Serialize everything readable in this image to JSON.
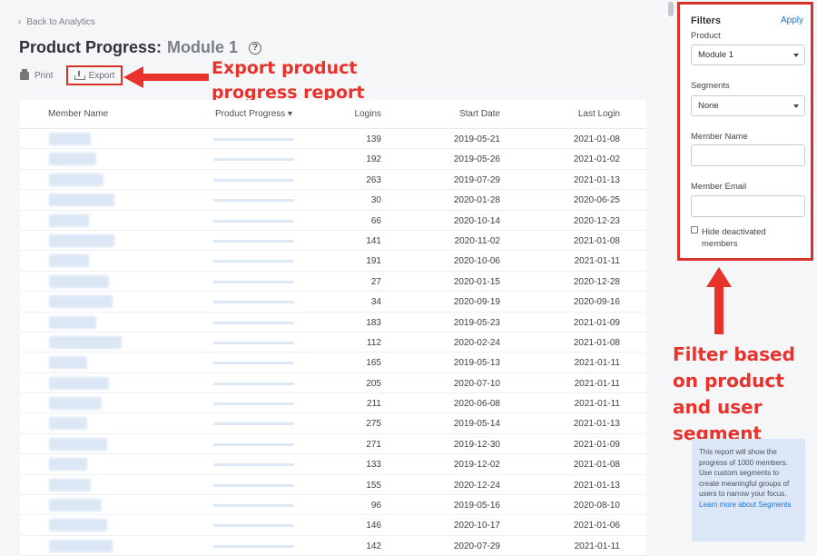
{
  "nav": {
    "back_label": "Back to Analytics"
  },
  "header": {
    "title": "Product Progress:",
    "subtitle": "Module 1",
    "help_glyph": "?"
  },
  "toolbar": {
    "print_label": "Print",
    "export_label": "Export"
  },
  "annotations": {
    "export": "Export product progress report",
    "filter": "Filter based on product and user segment",
    "color": "#e8322b"
  },
  "table": {
    "columns": [
      "Member Name",
      "Product Progress ▾",
      "Logins",
      "Start Date",
      "Last Login"
    ],
    "rows": [
      {
        "name_width": 46,
        "progress": 0.93,
        "logins": "139",
        "start": "2019-05-21",
        "last": "2021-01-08"
      },
      {
        "name_width": 52,
        "progress": 0.86,
        "logins": "192",
        "start": "2019-05-26",
        "last": "2021-01-02"
      },
      {
        "name_width": 60,
        "progress": 0.7,
        "logins": "263",
        "start": "2019-07-29",
        "last": "2021-01-13"
      },
      {
        "name_width": 72,
        "progress": 0.38,
        "logins": "30",
        "start": "2020-01-28",
        "last": "2020-06-25"
      },
      {
        "name_width": 44,
        "progress": 0.14,
        "logins": "66",
        "start": "2020-10-14",
        "last": "2020-12-23"
      },
      {
        "name_width": 72,
        "progress": 0.14,
        "logins": "141",
        "start": "2020-11-02",
        "last": "2021-01-08"
      },
      {
        "name_width": 44,
        "progress": 0.14,
        "logins": "191",
        "start": "2020-10-06",
        "last": "2021-01-11"
      },
      {
        "name_width": 66,
        "progress": 0.14,
        "logins": "27",
        "start": "2020-01-15",
        "last": "2020-12-28"
      },
      {
        "name_width": 70,
        "progress": 0.14,
        "logins": "34",
        "start": "2020-09-19",
        "last": "2020-09-16"
      },
      {
        "name_width": 52,
        "progress": 0.14,
        "logins": "183",
        "start": "2019-05-23",
        "last": "2021-01-09"
      },
      {
        "name_width": 80,
        "progress": 0.14,
        "logins": "112",
        "start": "2020-02-24",
        "last": "2021-01-08"
      },
      {
        "name_width": 42,
        "progress": 0.14,
        "logins": "165",
        "start": "2019-05-13",
        "last": "2021-01-11"
      },
      {
        "name_width": 66,
        "progress": 0.14,
        "logins": "205",
        "start": "2020-07-10",
        "last": "2021-01-11"
      },
      {
        "name_width": 58,
        "progress": 0.14,
        "logins": "211",
        "start": "2020-06-08",
        "last": "2021-01-11"
      },
      {
        "name_width": 42,
        "progress": 0.14,
        "logins": "275",
        "start": "2019-05-14",
        "last": "2021-01-13"
      },
      {
        "name_width": 64,
        "progress": 0.14,
        "logins": "271",
        "start": "2019-12-30",
        "last": "2021-01-09"
      },
      {
        "name_width": 42,
        "progress": 0.14,
        "logins": "133",
        "start": "2019-12-02",
        "last": "2021-01-08"
      },
      {
        "name_width": 46,
        "progress": 0.14,
        "logins": "155",
        "start": "2020-12-24",
        "last": "2021-01-13"
      },
      {
        "name_width": 58,
        "progress": 0.14,
        "logins": "96",
        "start": "2019-05-16",
        "last": "2020-08-10"
      },
      {
        "name_width": 64,
        "progress": 0.14,
        "logins": "146",
        "start": "2020-10-17",
        "last": "2021-01-06"
      },
      {
        "name_width": 70,
        "progress": 0.14,
        "logins": "142",
        "start": "2020-07-29",
        "last": "2021-01-11"
      }
    ]
  },
  "filters": {
    "title": "Filters",
    "apply_label": "Apply",
    "product_label": "Product",
    "product_value": "Module 1",
    "segments_label": "Segments",
    "segments_value": "None",
    "member_name_label": "Member Name",
    "member_name_value": "",
    "member_email_label": "Member Email",
    "member_email_value": "",
    "hide_deactivated_label": "Hide deactivated members",
    "hide_deactivated_checked": false
  },
  "info": {
    "text": "This report will show the progress of 1000 members. Use custom segments to create meaningful groups of users to narrow your focus.",
    "link": "Learn more about Segments"
  },
  "colors": {
    "accent": "#1a73d9",
    "highlight": "#d9322b",
    "info_bg": "#dbe7f7"
  }
}
